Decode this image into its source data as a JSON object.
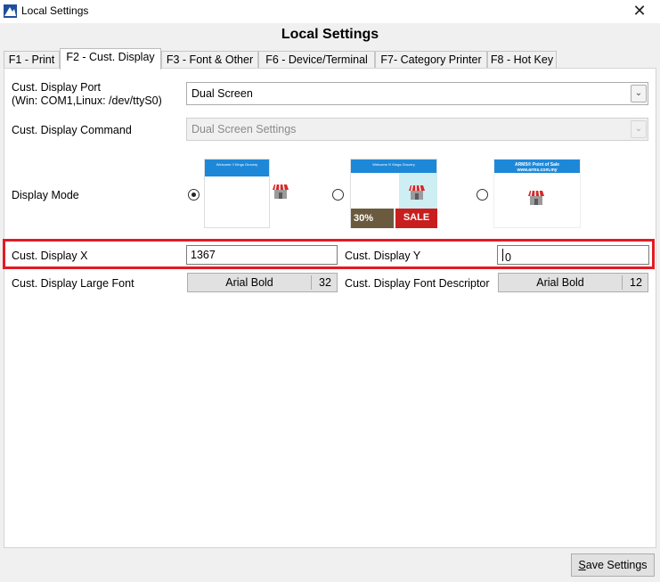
{
  "window": {
    "title": "Local Settings",
    "close_glyph": "✕"
  },
  "heading": "Local Settings",
  "tabs": [
    {
      "label": "F1 - Print"
    },
    {
      "label": "F2 - Cust. Display",
      "active": true
    },
    {
      "label": "F3 - Font & Other"
    },
    {
      "label": "F6 - Device/Terminal"
    },
    {
      "label": "F7- Category Printer"
    },
    {
      "label": "F8 - Hot Key"
    }
  ],
  "port": {
    "label_line1": "Cust. Display Port",
    "label_line2": "(Win: COM1,Linux: /dev/ttyS0)",
    "value": "Dual Screen",
    "arrow": "⌄"
  },
  "command": {
    "label": "Cust. Display Command",
    "value": "Dual Screen Settings",
    "arrow": "⌄"
  },
  "display_mode": {
    "label": "Display Mode",
    "selected_index": 0,
    "options": [
      {
        "bar_text": "Welcome !! Kings Grocery"
      },
      {
        "bar_text": "Welcome !!! Kings Grocery",
        "promo_left": "30%",
        "promo_right": "SALE"
      },
      {
        "bar_text": "ARMS® Point of Sale www.arms.com.my"
      }
    ]
  },
  "display_x": {
    "label": "Cust. Display X",
    "value": "1367"
  },
  "display_y": {
    "label": "Cust. Display Y",
    "value": "0"
  },
  "large_font": {
    "label": "Cust. Display Large Font",
    "font": "Arial Bold",
    "size": "32"
  },
  "font_descriptor": {
    "label": "Cust. Display Font Descriptor",
    "font": "Arial Bold",
    "size": "12"
  },
  "save": {
    "label_underlined": "S",
    "label_rest": "ave Settings"
  },
  "colors": {
    "highlight": "#e21b24",
    "preview_bar": "#1e88d8"
  }
}
